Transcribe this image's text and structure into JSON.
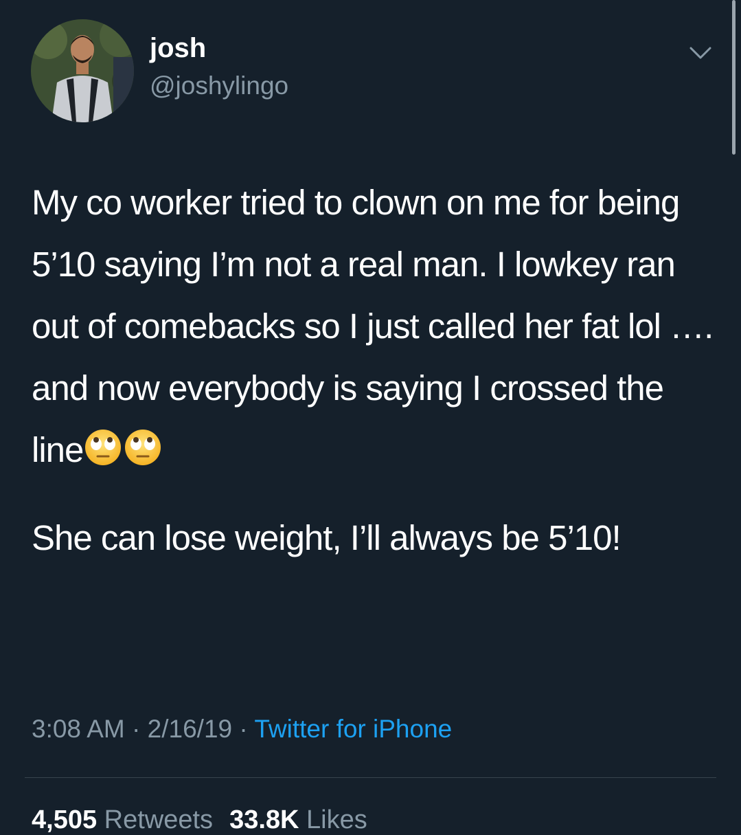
{
  "tweet": {
    "author": {
      "name": "josh",
      "handle": "@joshylingo"
    },
    "paragraph1": {
      "text": "My co worker tried to clown on me for being 5’10 saying I’m not a real man. I lowkey ran out of comebacks so I just called her fat lol …. and now everybody is saying I crossed the line"
    },
    "paragraph2": {
      "text": "She can lose weight, I’ll always be 5’10!"
    },
    "meta": {
      "time": "3:08 AM",
      "sep1": " · ",
      "date": "2/16/19",
      "sep2": " · ",
      "source": "Twitter for iPhone"
    },
    "stats": {
      "retweets_count": "4,505",
      "retweets_label": "Retweets",
      "likes_count": "33.8K",
      "likes_label": "Likes"
    },
    "icons": {
      "menu": "chevron-down-icon",
      "emoji": "face-with-rolling-eyes"
    },
    "colors": {
      "background": "#15202b",
      "secondary_text": "#8899a6",
      "link": "#1da1f2"
    }
  }
}
